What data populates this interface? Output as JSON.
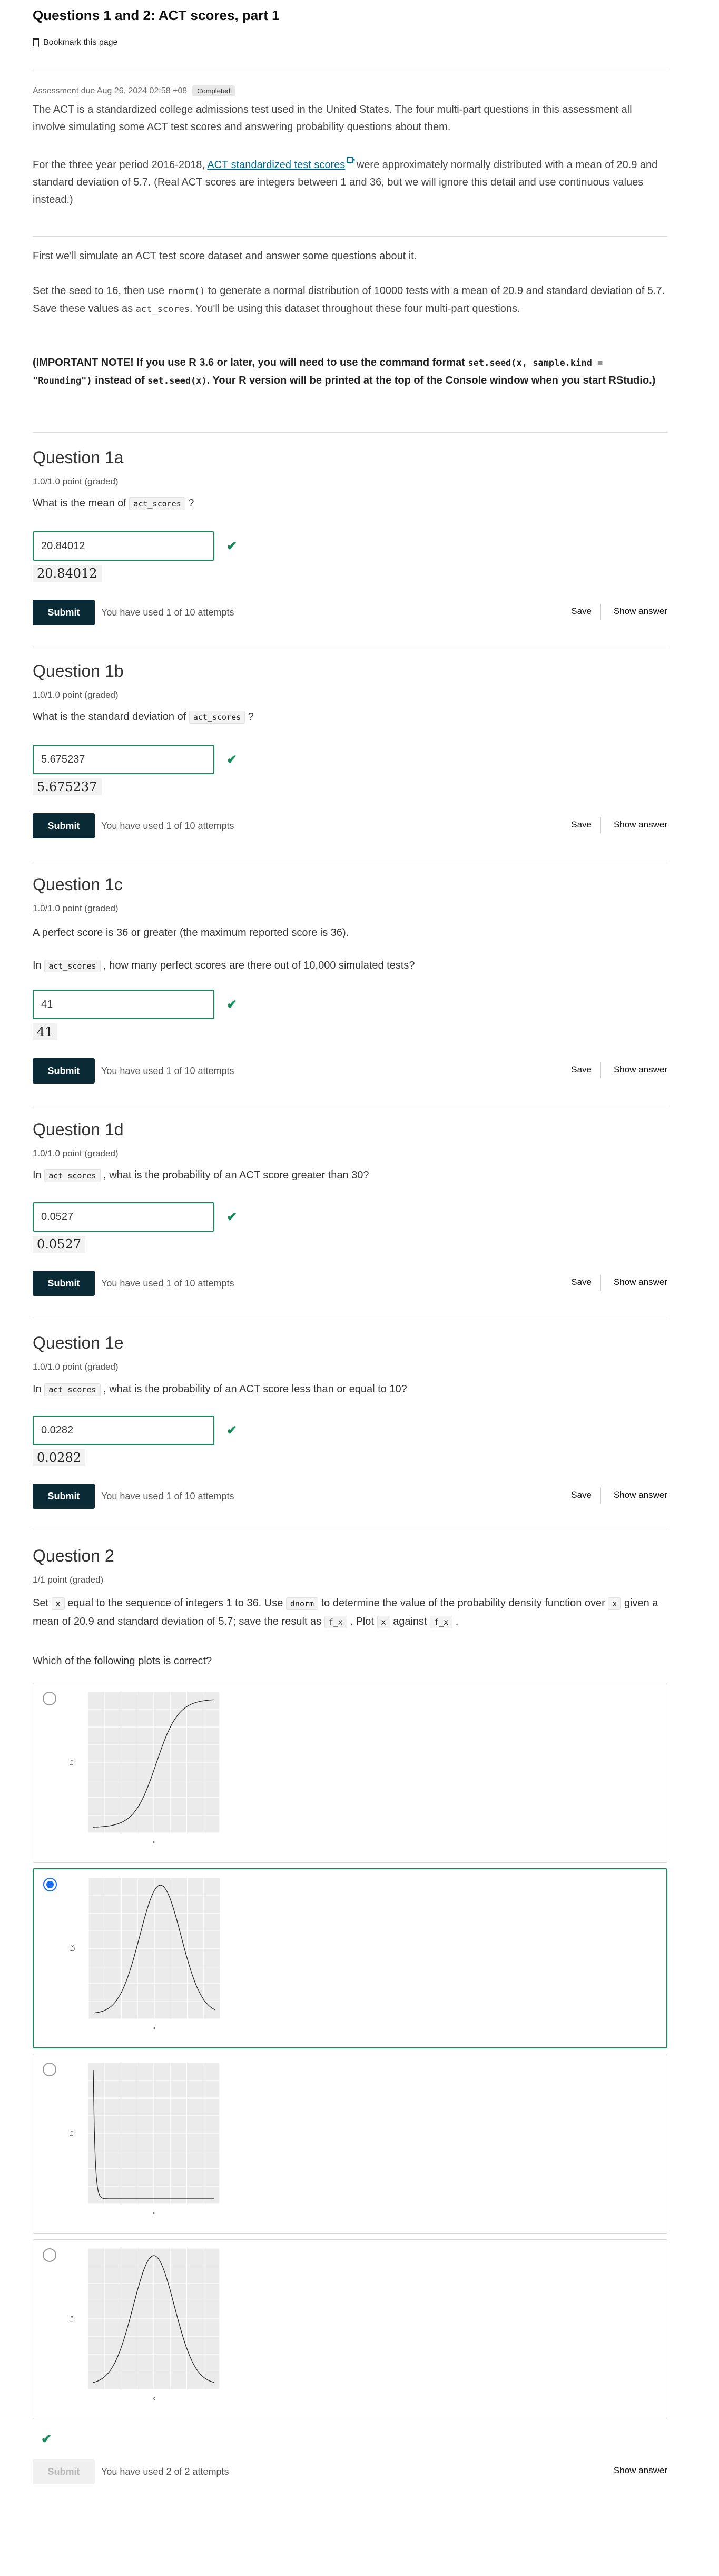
{
  "header": {
    "title": "Questions 1 and 2: ACT scores, part 1",
    "bookmark_label": "Bookmark this page"
  },
  "meta": {
    "due": "Assessment due Aug 26, 2024 02:58 +08",
    "status": "Completed"
  },
  "intro": {
    "p1": "The ACT is a standardized college admissions test used in the United States. The four multi-part questions in this assessment all involve simulating some ACT test scores and answering probability questions about them.",
    "p2_before": "For the three year period 2016-2018, ",
    "p2_link": "ACT standardized test scores",
    "p2_after": " were approximately normally distributed with a mean of 20.9 and standard deviation of 5.7. (Real ACT scores are integers between 1 and 36, but we will ignore this detail and use continuous values instead.)",
    "p3": "First we'll simulate an ACT test score dataset and answer some questions about it.",
    "p4_a": "Set the seed to 16, then use ",
    "p4_code1": "rnorm()",
    "p4_b": " to generate a normal distribution of 10000 tests with a mean of 20.9 and standard deviation of 5.7. Save these values as ",
    "p4_code2": "act_scores",
    "p4_c": ". You'll be using this dataset throughout these four multi-part questions.",
    "note_a": "(IMPORTANT NOTE! If you use R 3.6 or later, you will need to use the command format ",
    "note_code1": "set.seed(x, sample.kind = \"Rounding\")",
    "note_b": " instead of ",
    "note_code2": "set.seed(x)",
    "note_c": ". Your R version will be printed at the top of the Console window when you start RStudio.)"
  },
  "actions": {
    "submit": "Submit",
    "save": "Save",
    "show_answer": "Show answer"
  },
  "questions": [
    {
      "title": "Question 1a",
      "points": "1.0/1.0 point (graded)",
      "pre": "",
      "text_before": "What is the mean of ",
      "code": "act_scores",
      "text_after": " ?",
      "answer": "20.84012",
      "preview": "20.84012",
      "attempts": "You have used 1 of 10 attempts"
    },
    {
      "title": "Question 1b",
      "points": "1.0/1.0 point (graded)",
      "pre": "",
      "text_before": "What is the standard deviation of ",
      "code": "act_scores",
      "text_after": " ?",
      "answer": "5.675237",
      "preview": "5.675237",
      "attempts": "You have used 1 of 10 attempts"
    },
    {
      "title": "Question 1c",
      "points": "1.0/1.0 point (graded)",
      "pre": "A perfect score is 36 or greater (the maximum reported score is 36).",
      "text_before": "In ",
      "code": "act_scores",
      "text_after": " , how many perfect scores are there out of 10,000 simulated tests?",
      "answer": "41",
      "preview": "41",
      "attempts": "You have used 1 of 10 attempts"
    },
    {
      "title": "Question 1d",
      "points": "1.0/1.0 point (graded)",
      "pre": "",
      "text_before": "In ",
      "code": "act_scores",
      "text_after": " , what is the probability of an ACT score greater than 30?",
      "answer": "0.0527",
      "preview": "0.0527",
      "attempts": "You have used 1 of 10 attempts"
    },
    {
      "title": "Question 1e",
      "points": "1.0/1.0 point (graded)",
      "pre": "",
      "text_before": "In ",
      "code": "act_scores",
      "text_after": " , what is the probability of an ACT score less than or equal to 10?",
      "answer": "0.0282",
      "preview": "0.0282",
      "attempts": "You have used 1 of 10 attempts"
    }
  ],
  "q2": {
    "title": "Question 2",
    "points": "1/1 point (graded)",
    "t1": "Set ",
    "c1": "x",
    "t2": " equal to the sequence of integers 1 to 36. Use ",
    "c2": "dnorm",
    "t3": " to determine the value of the probability density function over ",
    "c3": "x",
    "t4": " given a mean of 20.9 and standard deviation of 5.7; save the result as ",
    "c4": "f_x",
    "t5": " . Plot ",
    "c5": "x",
    "t6": " against ",
    "c6": "f_x",
    "t7": " .",
    "prompt": "Which of the following plots is correct?",
    "selected_index": 1,
    "choices": [
      {
        "shape": "cdf",
        "xlabel": "x",
        "ylabel": "f_x"
      },
      {
        "shape": "pdf",
        "xlabel": "x",
        "ylabel": "f_x"
      },
      {
        "shape": "decay",
        "xlabel": "x",
        "ylabel": "f_x"
      },
      {
        "shape": "pdf-narrow",
        "xlabel": "x",
        "ylabel": "f_x"
      }
    ],
    "attempts": "You have used 2 of 2 attempts"
  },
  "colors": {
    "correct": "#178a5b",
    "submit_bg": "#0a2a35",
    "link": "#00688d",
    "radio_selected": "#1d6df2"
  }
}
